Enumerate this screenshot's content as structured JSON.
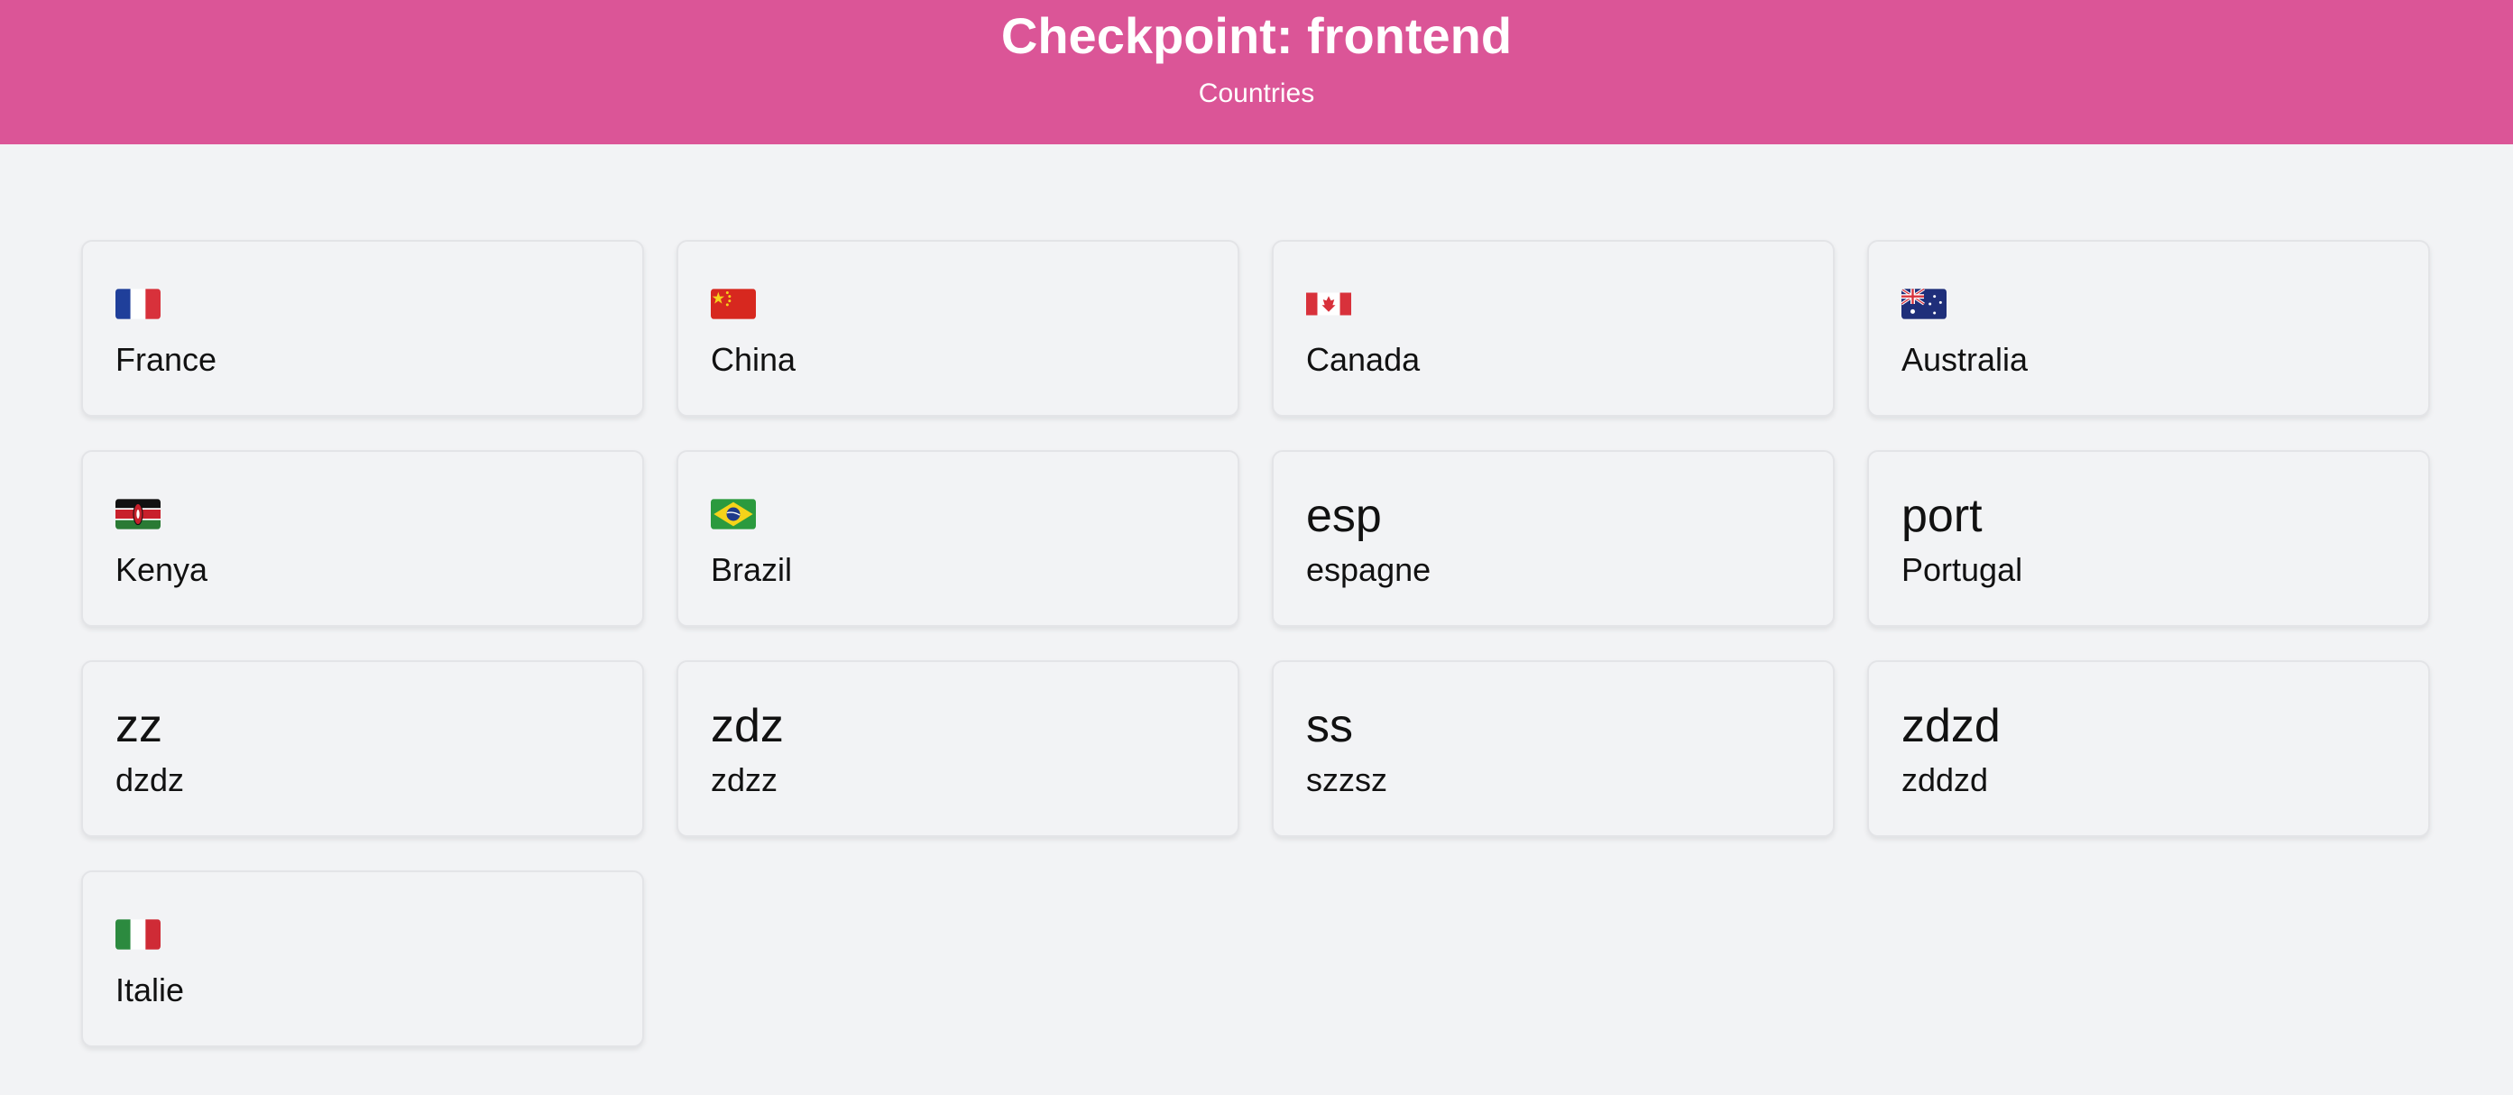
{
  "header": {
    "title": "Checkpoint: frontend",
    "subtitle": "Countries",
    "background_color": "#db5597"
  },
  "countries": [
    {
      "flag": "flag-france-icon",
      "code": "",
      "name": "France"
    },
    {
      "flag": "flag-china-icon",
      "code": "",
      "name": "China"
    },
    {
      "flag": "flag-canada-icon",
      "code": "",
      "name": "Canada"
    },
    {
      "flag": "flag-australia-icon",
      "code": "",
      "name": "Australia"
    },
    {
      "flag": "flag-kenya-icon",
      "code": "",
      "name": "Kenya"
    },
    {
      "flag": "flag-brazil-icon",
      "code": "",
      "name": "Brazil"
    },
    {
      "flag": "",
      "code": "esp",
      "name": "espagne"
    },
    {
      "flag": "",
      "code": "port",
      "name": "Portugal"
    },
    {
      "flag": "",
      "code": "zz",
      "name": "dzdz"
    },
    {
      "flag": "",
      "code": "zdz",
      "name": "zdzz"
    },
    {
      "flag": "",
      "code": "ss",
      "name": "szzsz"
    },
    {
      "flag": "",
      "code": "zdzd",
      "name": "zddzd"
    },
    {
      "flag": "flag-italy-icon",
      "code": "",
      "name": "Italie"
    }
  ]
}
